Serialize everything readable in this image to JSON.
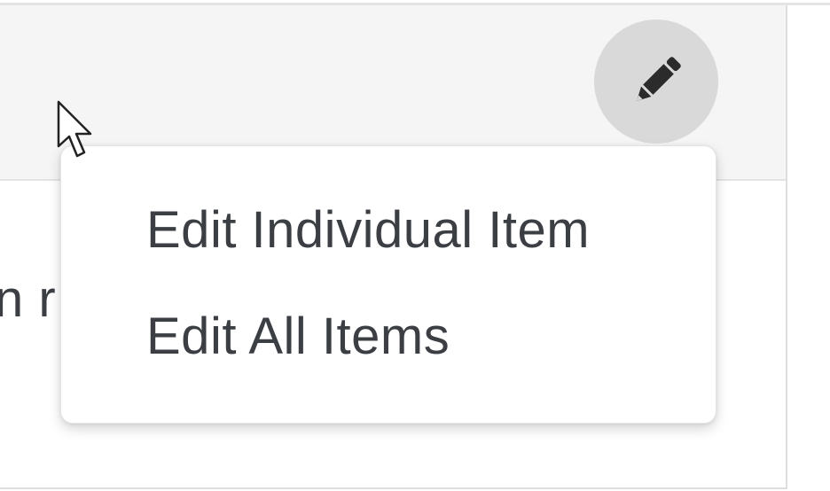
{
  "page": {
    "background_text": "n r"
  },
  "header": {
    "edit_button_icon": "pencil-icon"
  },
  "edit_menu": {
    "items": [
      {
        "label": "Edit Individual Item"
      },
      {
        "label": "Edit All Items"
      }
    ]
  },
  "colors": {
    "header_bg": "#f5f5f5",
    "fab_bg": "#d9d9d9",
    "icon": "#2b2b2b",
    "text": "#3b3f44",
    "menu_bg": "#ffffff"
  }
}
